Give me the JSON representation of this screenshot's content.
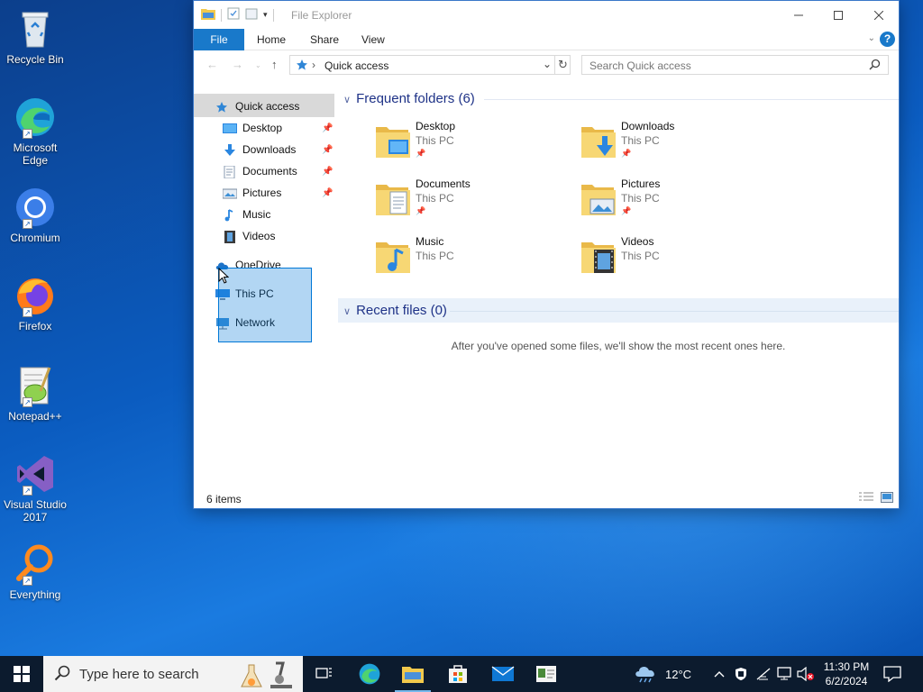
{
  "desktop": {
    "icons": [
      {
        "label": "Recycle Bin"
      },
      {
        "label": "Microsoft Edge"
      },
      {
        "label": "Chromium"
      },
      {
        "label": "Firefox"
      },
      {
        "label": "Notepad++"
      },
      {
        "label": "Visual Studio 2017"
      },
      {
        "label": "Everything"
      }
    ]
  },
  "window": {
    "title": "File Explorer",
    "ribbon_tabs": [
      "File",
      "Home",
      "Share",
      "View"
    ],
    "help_label": "?",
    "address": {
      "crumb": "Quick access"
    },
    "search": {
      "placeholder": "Search Quick access"
    },
    "nav": {
      "quick_access": "Quick access",
      "pinned": [
        "Desktop",
        "Downloads",
        "Documents",
        "Pictures"
      ],
      "unpinned": [
        "Music",
        "Videos"
      ],
      "onedrive": "OneDrive",
      "this_pc": "This PC",
      "network": "Network"
    },
    "frequent": {
      "header": "Frequent folders (6)",
      "folders": [
        {
          "name": "Desktop",
          "location": "This PC",
          "pinned": true
        },
        {
          "name": "Downloads",
          "location": "This PC",
          "pinned": true
        },
        {
          "name": "Documents",
          "location": "This PC",
          "pinned": true
        },
        {
          "name": "Pictures",
          "location": "This PC",
          "pinned": true
        },
        {
          "name": "Music",
          "location": "This PC",
          "pinned": false
        },
        {
          "name": "Videos",
          "location": "This PC",
          "pinned": false
        }
      ]
    },
    "recent": {
      "header": "Recent files (0)",
      "empty_text": "After you've opened some files, we'll show the most recent ones here."
    },
    "status": "6 items"
  },
  "taskbar": {
    "search_placeholder": "Type here to search",
    "weather": "12°C",
    "time": "11:30 PM",
    "date": "6/2/2024"
  },
  "colors": {
    "accent": "#1979ca",
    "selection": "#0078d7",
    "folder_yellow": "#f7d774"
  }
}
